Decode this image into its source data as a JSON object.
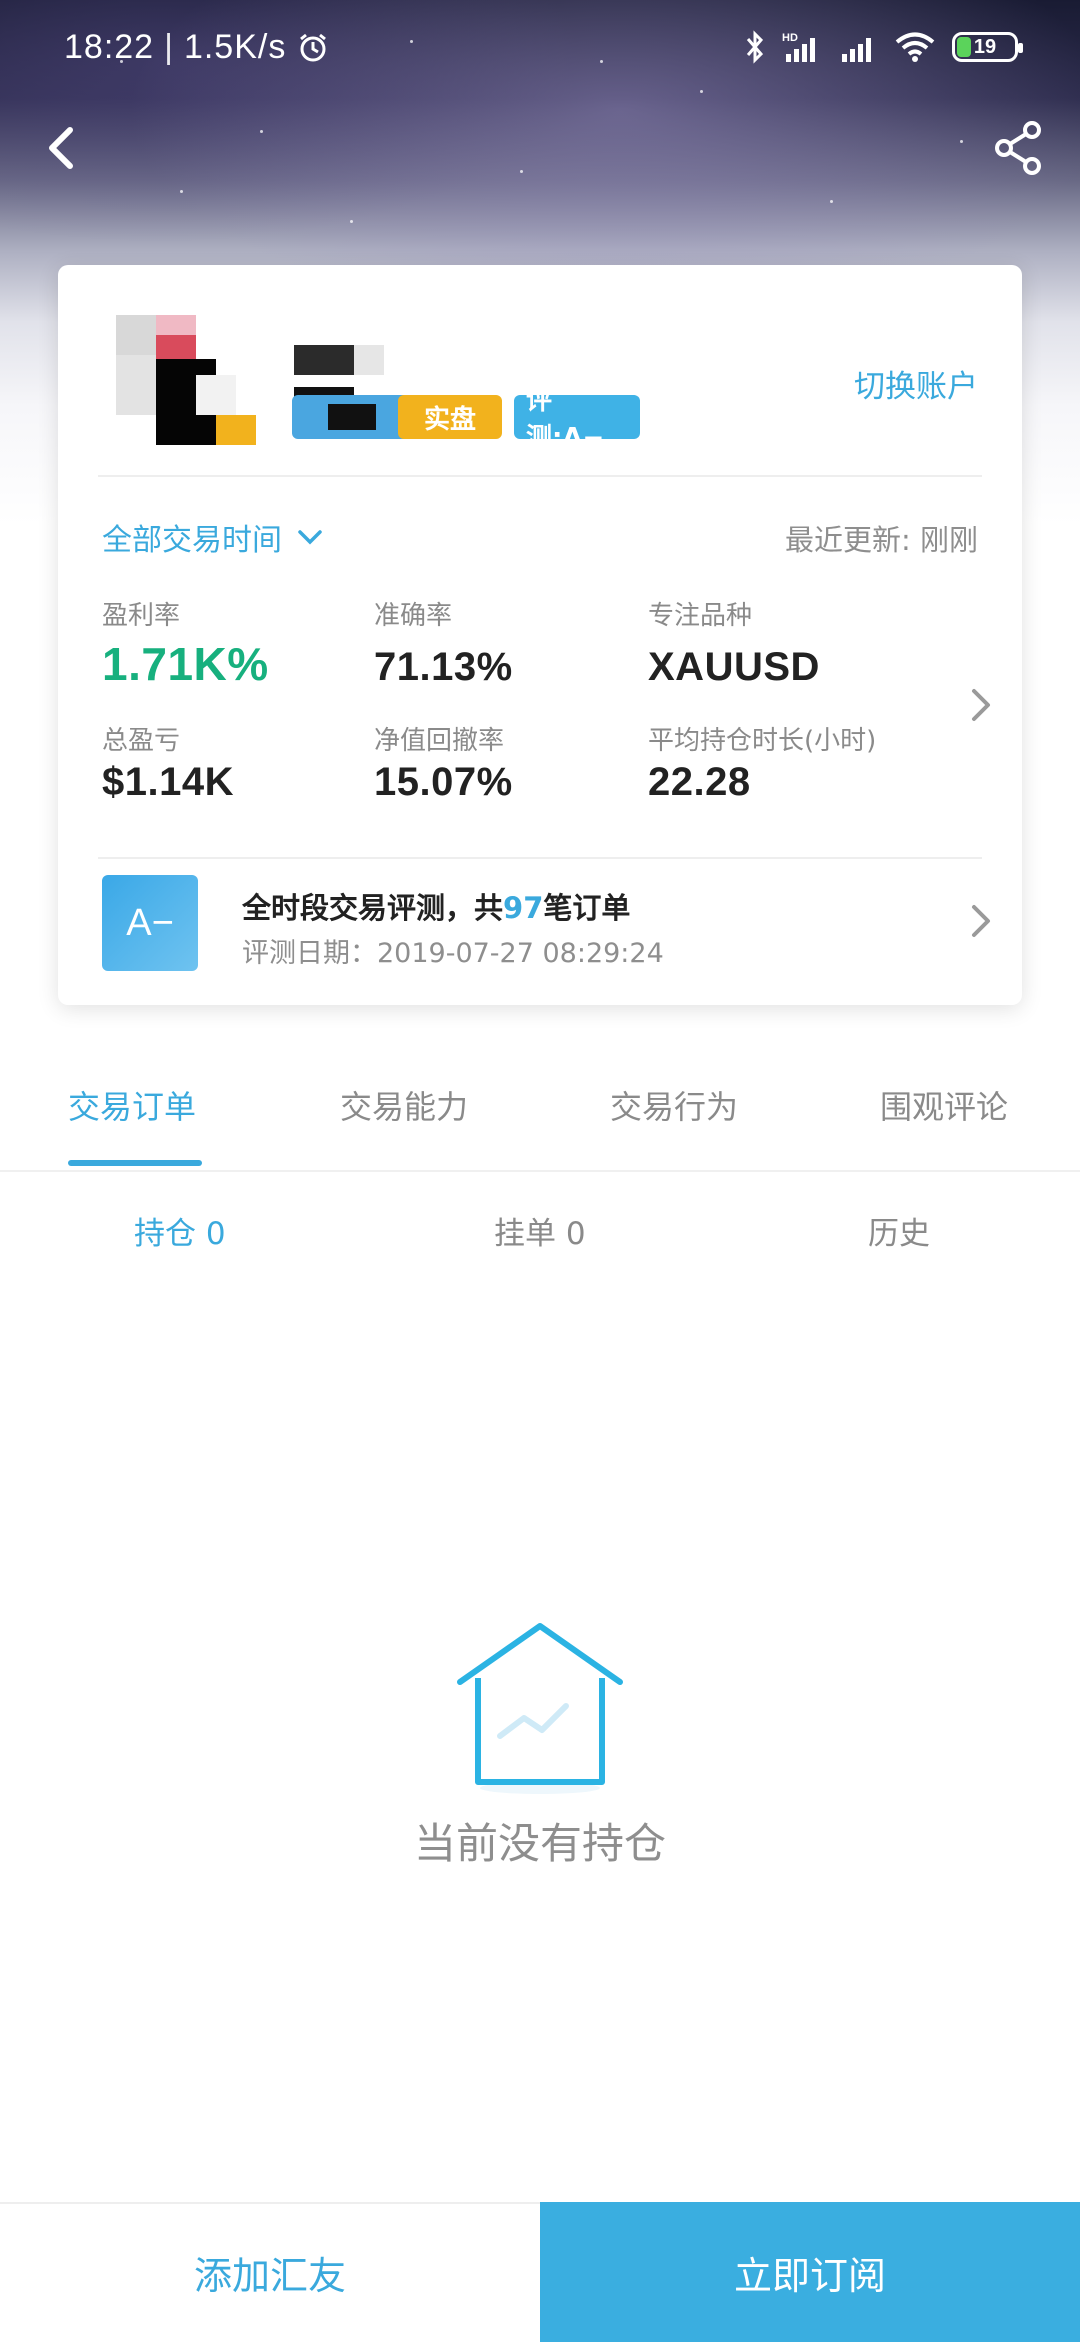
{
  "status_bar": {
    "time": "18:22",
    "separator": "|",
    "network_speed": "1.5K/s",
    "battery_level": "19"
  },
  "profile": {
    "badge_real": "实盘",
    "badge_rating": "评测:A−",
    "switch_account_label": "切换账户"
  },
  "summary": {
    "period_label": "全部交易时间",
    "updated_label": "最近更新: 刚刚",
    "stats": {
      "profit_rate_label": "盈利率",
      "profit_rate_value": "1.71K%",
      "accuracy_label": "准确率",
      "accuracy_value": "71.13%",
      "focus_symbol_label": "专注品种",
      "focus_symbol_value": "XAUUSD",
      "total_pnl_label": "总盈亏",
      "total_pnl_value": "$1.14K",
      "drawdown_label": "净值回撤率",
      "drawdown_value": "15.07%",
      "avg_hold_label": "平均持仓时长(小时)",
      "avg_hold_value": "22.28"
    }
  },
  "evaluation": {
    "grade": "A−",
    "title_prefix": "全时段交易评测，共",
    "order_count": "97",
    "title_suffix": "笔订单",
    "date": "评测日期：2019-07-27 08:29:24"
  },
  "tabs": [
    "交易订单",
    "交易能力",
    "交易行为",
    "围观评论"
  ],
  "subtabs": [
    "持仓 0",
    "挂单 0",
    "历史"
  ],
  "empty_state": {
    "message": "当前没有持仓"
  },
  "bottom_bar": {
    "add_friend_label": "添加汇友",
    "subscribe_label": "立即订阅"
  },
  "colors": {
    "accent": "#3aa9dd",
    "profit_green": "#17b07e",
    "badge_yellow": "#f2b21d",
    "subscribe_bg": "#3aaee0"
  },
  "icons": [
    "back-arrow-icon",
    "share-icon",
    "bluetooth-icon",
    "signal-icon",
    "wifi-icon",
    "alarm-icon",
    "chevron-down-icon",
    "chevron-right-icon",
    "empty-house-icon"
  ]
}
